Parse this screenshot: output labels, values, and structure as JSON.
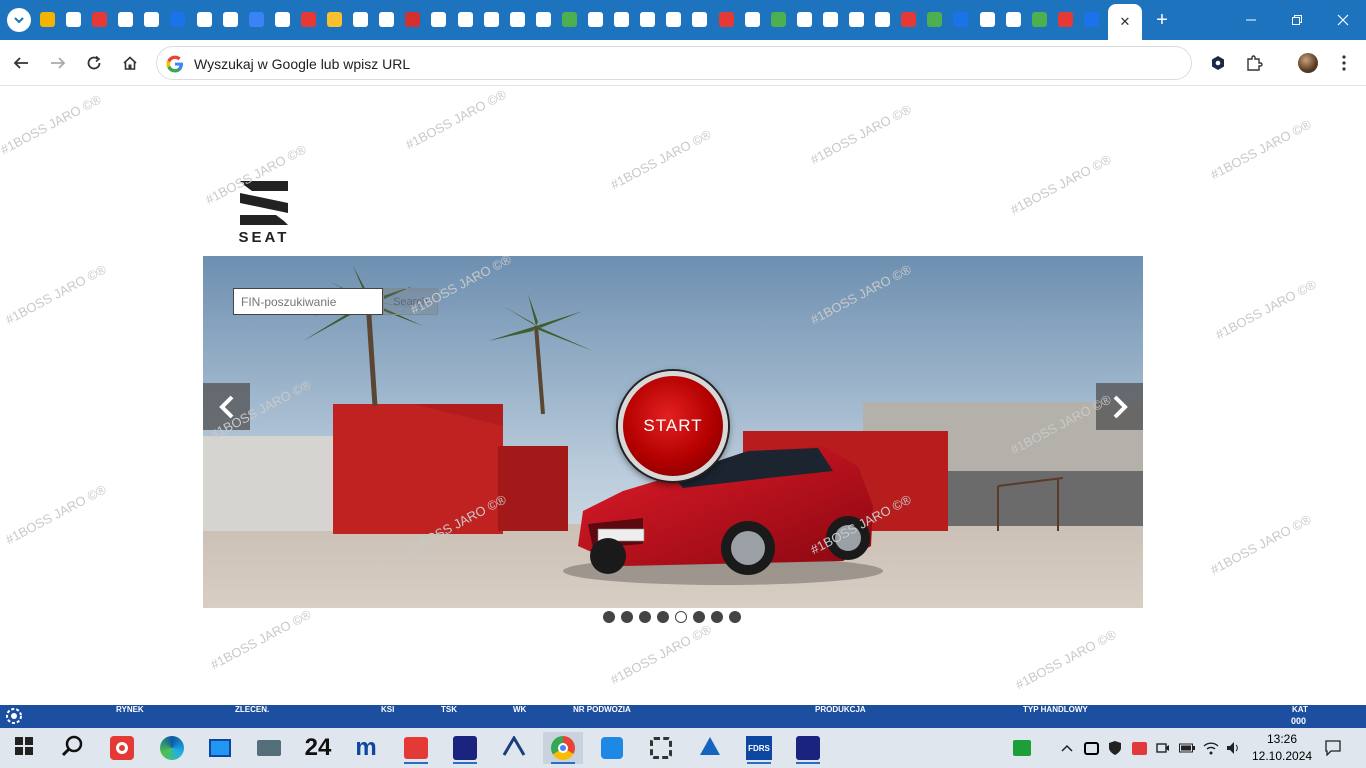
{
  "browser": {
    "omnibox_placeholder": "Wyszukaj w Google lub wpisz URL",
    "new_tab_symbol": "+",
    "close_tab_symbol": "✕"
  },
  "page": {
    "logo_text": "SEAT",
    "fin_placeholder": "FIN-poszukiwanie",
    "search_label": "Search",
    "start_label": "START",
    "slides_total": 8,
    "active_slide": 5,
    "watermark": "#1BOSS JARO ©®"
  },
  "statusbar": {
    "labels": [
      "RYNEK",
      "ZLECEN.",
      "KSI",
      "TSK",
      "WK",
      "NR PODWOZIA",
      "PRODUKCJA",
      "TYP HANDLOWY",
      "KAT"
    ],
    "kat_value": "000"
  },
  "taskbar": {
    "apps": [
      "windows-start",
      "search",
      "app-red-circle",
      "edge",
      "app-monitor",
      "app-laptop",
      "app-24",
      "app-m",
      "app-red-arrow",
      "app-odis",
      "app-triangle",
      "chrome",
      "app-remote",
      "app-gear",
      "app-a",
      "app-fdrs",
      "app-odis2"
    ],
    "time": "13:26",
    "date": "12.10.2024"
  },
  "colors": {
    "chrome_blue": "#1e73be",
    "status_blue": "#1d4fa1",
    "start_red": "#c00000"
  }
}
